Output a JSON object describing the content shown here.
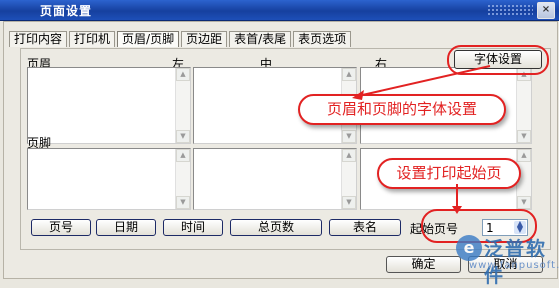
{
  "window": {
    "title": "页面设置",
    "close_glyph": "×"
  },
  "tabs": [
    {
      "label": "打印内容",
      "active": false
    },
    {
      "label": "打印机",
      "active": false
    },
    {
      "label": "页眉/页脚",
      "active": true
    },
    {
      "label": "页边距",
      "active": false
    },
    {
      "label": "表首/表尾",
      "active": false
    },
    {
      "label": "表页选项",
      "active": false
    }
  ],
  "header_section": {
    "label": "页眉",
    "left": "左",
    "center": "中",
    "right": "右",
    "font_button": "字体设置"
  },
  "footer_section": {
    "label": "页脚"
  },
  "insert_buttons": [
    "页号",
    "日期",
    "时间",
    "总页数",
    "表名"
  ],
  "start_page": {
    "label": "起始页号",
    "value": "1"
  },
  "footer_buttons": {
    "ok": "确定",
    "cancel": "取消"
  },
  "annotations": {
    "font_callout": "页眉和页脚的字体设置",
    "start_callout": "设置打印起始页"
  },
  "watermark": {
    "name": "泛普软件",
    "url": "www.fanpusoft.com",
    "color": "#2f6db0"
  },
  "colors": {
    "titlebar": "#1d4fb8",
    "annotation": "#e22222",
    "dialog_bg": "#eceae3"
  }
}
